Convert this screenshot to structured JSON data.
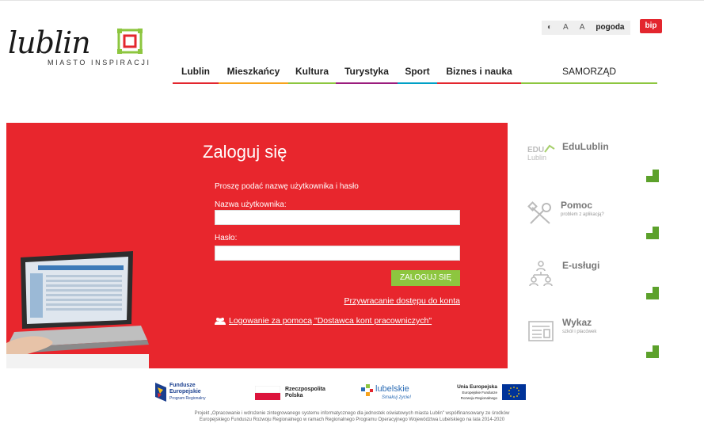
{
  "brand": {
    "name": "lublin",
    "tagline": "MIASTO INSPIRACJI"
  },
  "utility": {
    "contrast": "◐",
    "font_small": "A",
    "font_large": "A",
    "weather": "pogoda",
    "bip": "bip"
  },
  "nav": {
    "items": [
      {
        "label": "Lublin"
      },
      {
        "label": "Mieszkańcy"
      },
      {
        "label": "Kultura"
      },
      {
        "label": "Turystyka"
      },
      {
        "label": "Sport"
      },
      {
        "label": "Biznes i nauka"
      },
      {
        "label": "SAMORZĄD"
      }
    ]
  },
  "login": {
    "title": "Zaloguj się",
    "intro": "Proszę podać nazwę użytkownika i hasło",
    "username_label": "Nazwa użytkownika:",
    "username_value": "",
    "password_label": "Hasło:",
    "password_value": "",
    "submit": "ZALOGUJ SIĘ",
    "recover_link": "Przywracanie dostępu do konta",
    "provider_link": "Logowanie za pomocą \"Dostawca kont pracowniczych\""
  },
  "tiles": [
    {
      "title": "EduLublin",
      "subtitle": "",
      "icon": "edu-lublin-icon"
    },
    {
      "title": "Pomoc",
      "subtitle": "problem z aplikacją?",
      "icon": "tools-icon"
    },
    {
      "title": "E-usługi",
      "subtitle": "",
      "icon": "people-network-icon"
    },
    {
      "title": "Wykaz",
      "subtitle": "szkół i placówek",
      "icon": "list-document-icon"
    }
  ],
  "footer": {
    "logos": {
      "fe_line1": "Fundusze",
      "fe_line2": "Europejskie",
      "fe_line3": "Program Regionalny",
      "rp_line1": "Rzeczpospolita",
      "rp_line2": "Polska",
      "lub_line1": "lubelskie",
      "lub_line2": "Smakuj życie!",
      "ue_line1": "Unia Europejska",
      "ue_line2": "Europejskie Fundusze",
      "ue_line3": "Rozwoju Regionalnego"
    },
    "note_line1": "Projekt „Opracowanie i wdrożenie zintegrowanego systemu informatycznego dla jednostek oświatowych miasta Lublin\" współfinansowany ze środków",
    "note_line2": "Europejskiego Funduszu Rozwoju Regionalnego w ramach Regionalnego Programu Operacyjnego Województwa Lubelskiego na lata 2014-2020"
  },
  "colors": {
    "red": "#e8262d",
    "green": "#8dc63f",
    "tile_corner": "#5ca12b"
  }
}
